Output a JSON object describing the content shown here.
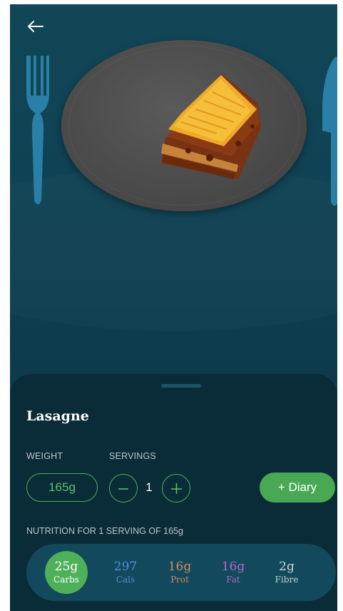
{
  "food": {
    "name": "Lasagne"
  },
  "labels": {
    "weight": "WEIGHT",
    "servings": "SERVINGS",
    "nutrition_header": "NUTRITION FOR 1 SERVING OF 165g"
  },
  "weight": {
    "value": "165g"
  },
  "servings": {
    "value": "1"
  },
  "diary_button": {
    "label": "+ Diary"
  },
  "nutrition": [
    {
      "value": "25g",
      "label": "Carbs",
      "color": "#ffffff"
    },
    {
      "value": "297",
      "label": "Cals",
      "color": "#4f8fd8"
    },
    {
      "value": "16g",
      "label": "Prot",
      "color": "#d08a5e"
    },
    {
      "value": "16g",
      "label": "Fat",
      "color": "#b36ac0"
    },
    {
      "value": "2g",
      "label": "Fibre",
      "color": "#c9d3d6"
    }
  ],
  "colors": {
    "accent": "#4fb05a",
    "background": "#0d3b4c",
    "sheet": "#0a2b38",
    "nutrition_bar": "#12495c"
  },
  "icons": [
    "back-arrow-icon",
    "fork-icon",
    "knife-icon",
    "minus-icon",
    "plus-icon"
  ]
}
